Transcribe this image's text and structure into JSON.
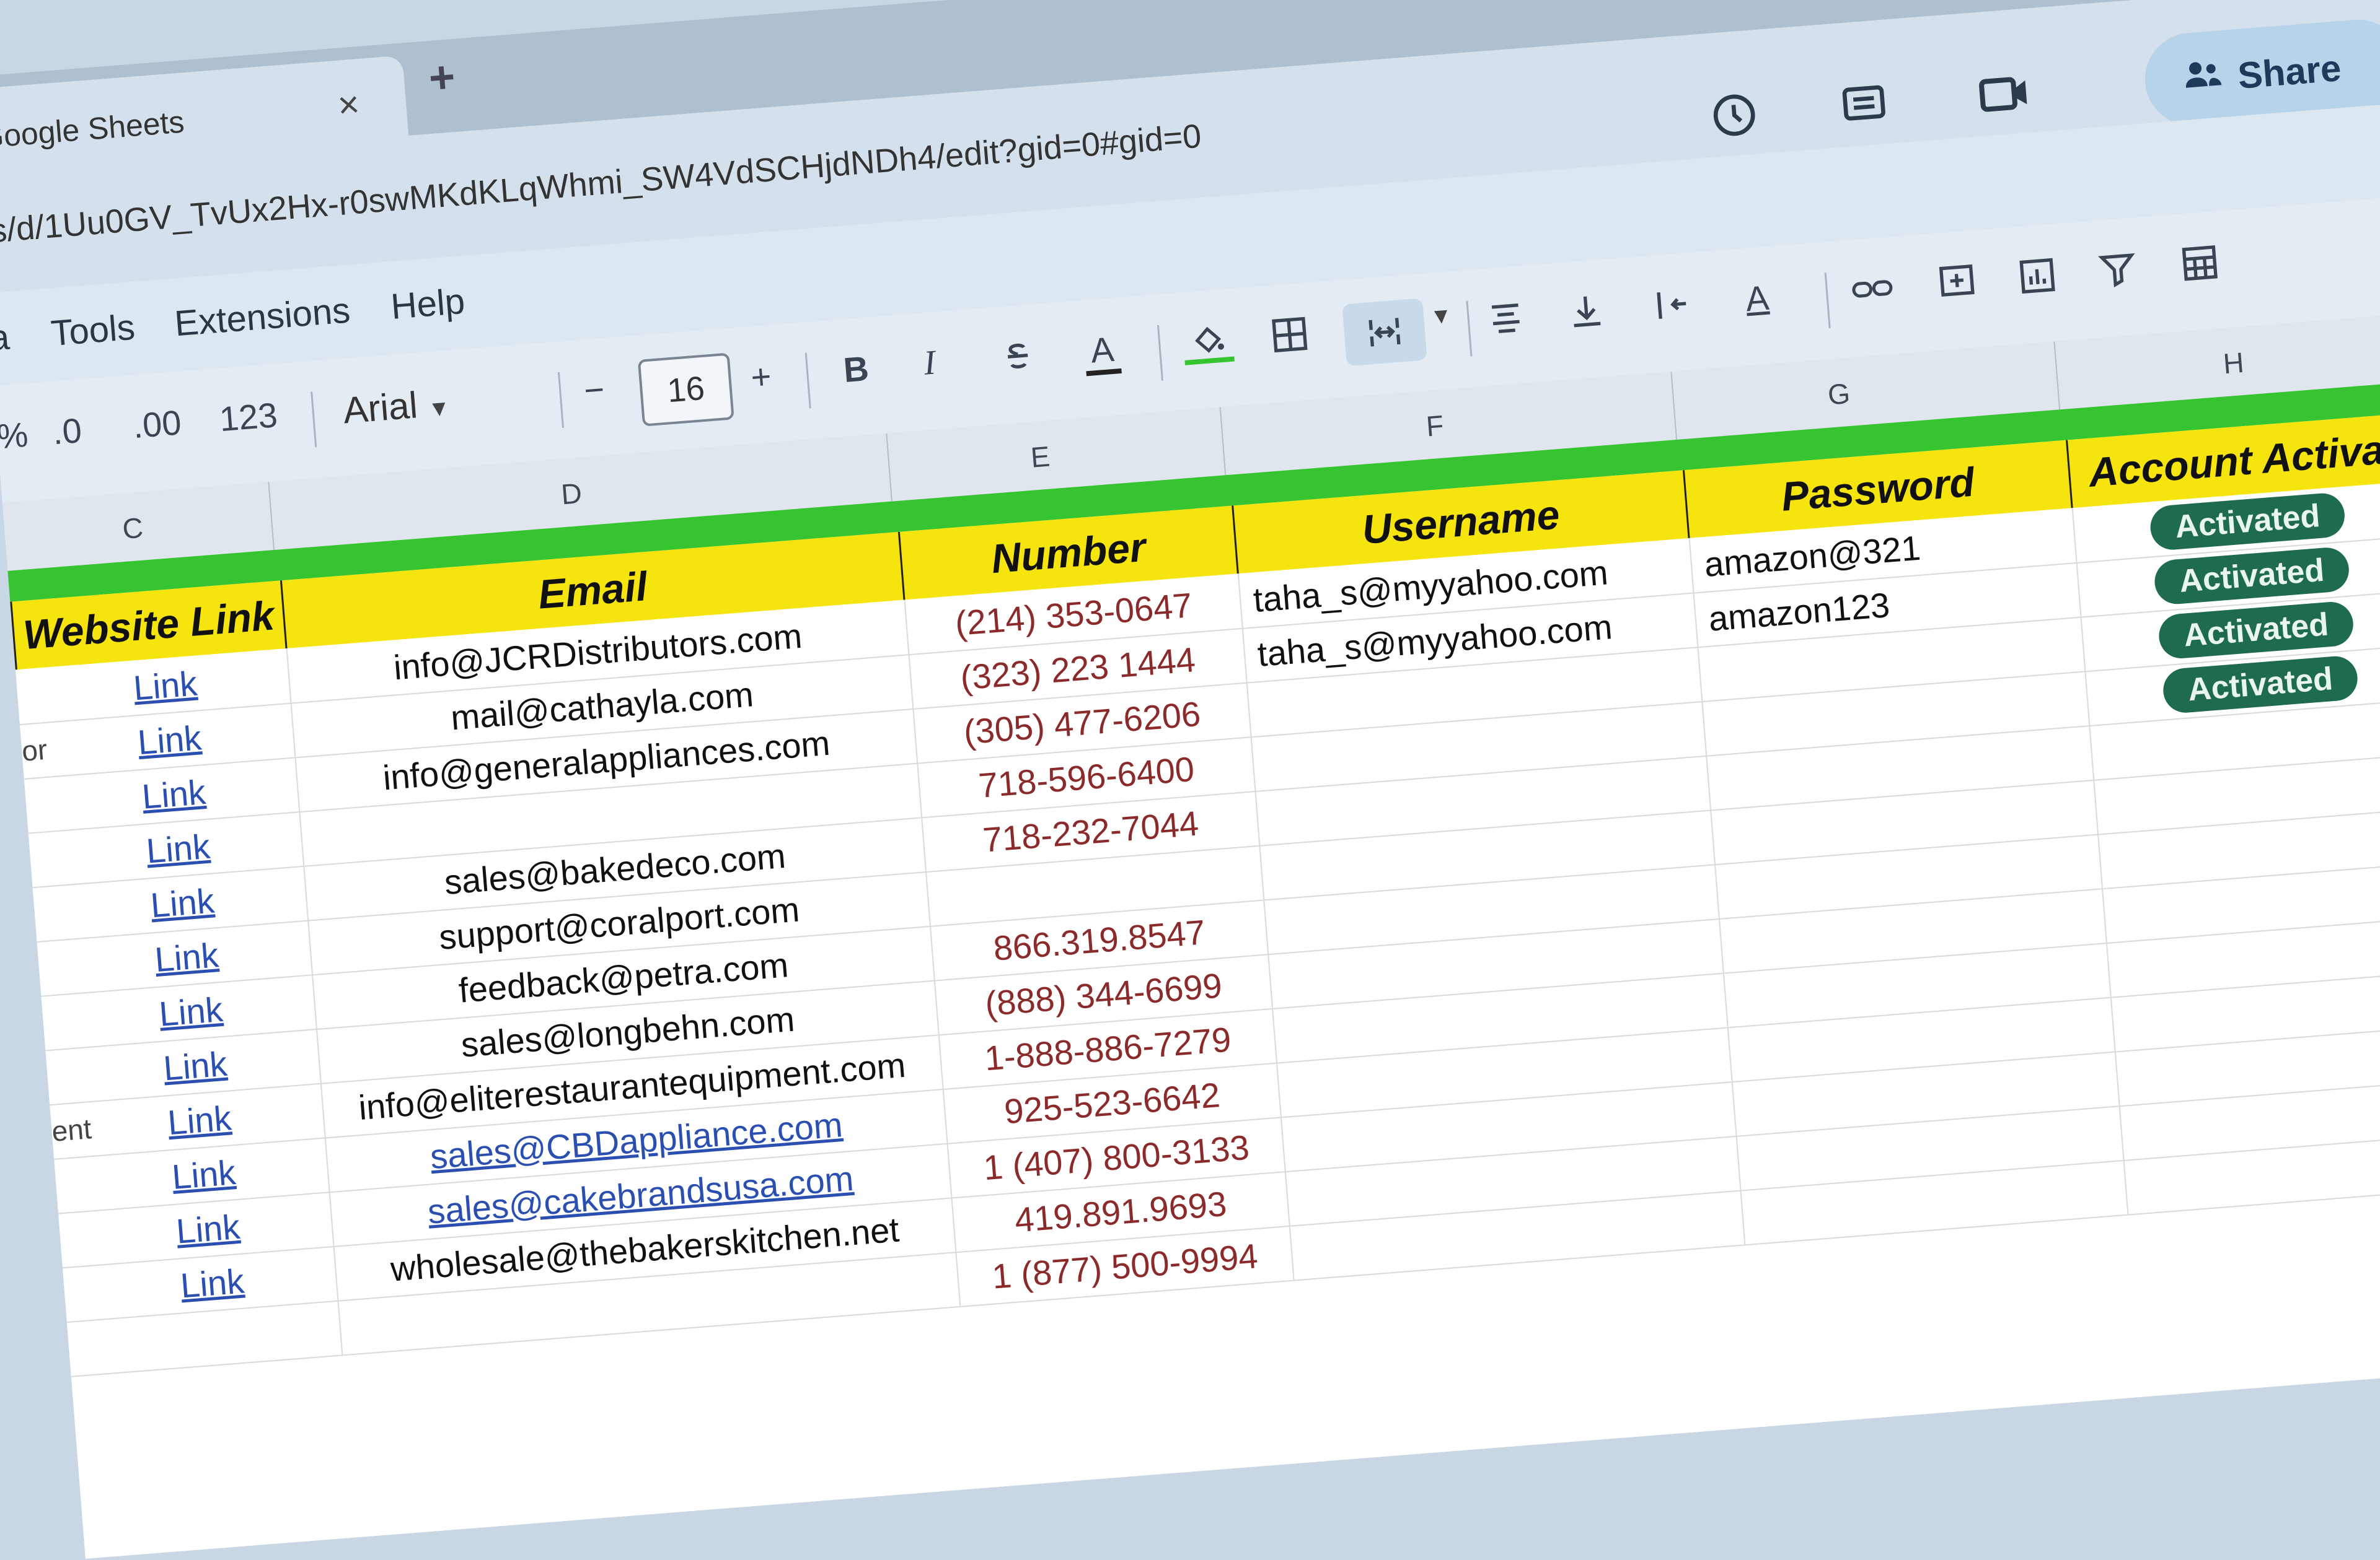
{
  "tab": {
    "title": "Google Sheets",
    "close": "×",
    "new_tab": "+"
  },
  "address": {
    "url": "ts/d/1Uu0GV_TvUx2Hx-r0swMKdKLqWhmi_SW4VdSCHjdNDh4/edit?gid=0#gid=0"
  },
  "header_icons": [
    "history-icon",
    "comment-icon",
    "meet-icon"
  ],
  "share": {
    "label": "Share",
    "icon": "people-icon"
  },
  "menu": [
    "a",
    "Tools",
    "Extensions",
    "Help"
  ],
  "toolbar": {
    "percent": "%",
    "dec_decrease": ".0",
    "dec_increase": ".00",
    "number_format": "123",
    "font": "Arial",
    "minus": "−",
    "font_size": "16",
    "plus": "+",
    "bold": "B",
    "italic": "I",
    "text_color": "A",
    "text_color_alt": "A"
  },
  "columns": [
    "C",
    "D",
    "E",
    "F",
    "G",
    "H"
  ],
  "headers": {
    "website_link": "Website Link",
    "email": "Email",
    "number": "Number",
    "username": "Username",
    "password": "Password",
    "account_activation": "Account Activa"
  },
  "row_heads": [
    "",
    "or",
    "",
    "",
    "",
    "",
    "",
    "",
    "ent",
    "",
    ""
  ],
  "rows": [
    {
      "link": "Link",
      "email": "info@JCRDistributors.com",
      "number": "(214) 353-0647",
      "username": "taha_s@myyahoo.com",
      "password": "amazon@321",
      "status": "Activated"
    },
    {
      "link": "Link",
      "email": "mail@cathayla.com",
      "number": "(323) 223 1444",
      "username": "taha_s@myyahoo.com",
      "password": "amazon123",
      "status": "Activated"
    },
    {
      "link": "Link",
      "email": "info@generalappliances.com",
      "number": "(305) 477-6206",
      "username": "",
      "password": "",
      "status": "Activated"
    },
    {
      "link": "Link",
      "email": "",
      "number": "718-596-6400",
      "username": "",
      "password": "",
      "status": "Activated"
    },
    {
      "link": "Link",
      "email": "sales@bakedeco.com",
      "number": "718-232-7044",
      "username": "",
      "password": "",
      "status": ""
    },
    {
      "link": "Link",
      "email": "support@coralport.com",
      "number": "",
      "username": "",
      "password": "",
      "status": ""
    },
    {
      "link": "Link",
      "email": "feedback@petra.com",
      "number": "866.319.8547",
      "username": "",
      "password": "",
      "status": ""
    },
    {
      "link": "Link",
      "email": "sales@longbehn.com",
      "number": "(888) 344-6699",
      "username": "",
      "password": "",
      "status": ""
    },
    {
      "link": "Link",
      "email": "info@eliterestaurantequipment.com",
      "number": "1-888-886-7279",
      "username": "",
      "password": "",
      "status": ""
    },
    {
      "link": "Link",
      "email": "sales@CBDappliance.com",
      "number": "925-523-6642",
      "username": "",
      "password": "",
      "status": ""
    },
    {
      "link": "Link",
      "email": "sales@cakebrandsusa.com",
      "number": "1 (407) 800-3133",
      "username": "",
      "password": "",
      "status": ""
    },
    {
      "link": "Link",
      "email": "wholesale@thebakerskitchen.net",
      "number": "419.891.9693",
      "username": "",
      "password": "",
      "status": ""
    },
    {
      "link": "",
      "email": "",
      "number": "1 (877) 500-9994",
      "username": "",
      "password": "",
      "status": ""
    }
  ],
  "colors": {
    "green_band": "#37c431",
    "header_yellow": "#f6e40e",
    "badge_green": "#1f6b4d",
    "link_blue": "#2a4fb0"
  }
}
